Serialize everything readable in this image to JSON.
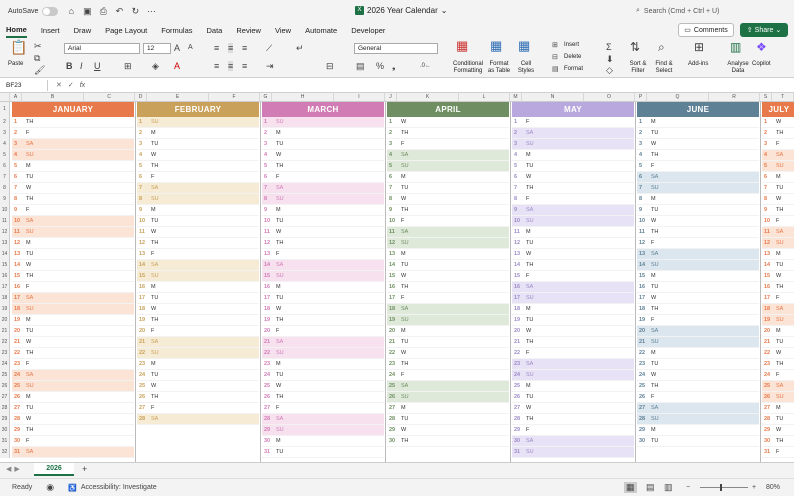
{
  "titlebar": {
    "autosave_label": "AutoSave",
    "doc_title": "2026 Year Calendar",
    "search_placeholder": "Search (Cmd + Ctrl + U)"
  },
  "menu": {
    "tabs": [
      "Home",
      "Insert",
      "Draw",
      "Page Layout",
      "Formulas",
      "Data",
      "Review",
      "View",
      "Automate",
      "Developer"
    ],
    "active": "Home",
    "comments_label": "Comments",
    "share_label": "Share"
  },
  "ribbon": {
    "paste": "Paste",
    "font_name": "Arial",
    "font_size": "12",
    "number_format": "General",
    "insert": "Insert",
    "delete": "Delete",
    "format": "Format",
    "cond_format_1": "Conditional",
    "cond_format_2": "Formatting",
    "format_table_1": "Format",
    "format_table_2": "as Table",
    "cell_styles_1": "Cell",
    "cell_styles_2": "Styles",
    "sort_1": "Sort &",
    "sort_2": "Filter",
    "find_1": "Find &",
    "find_2": "Select",
    "addins": "Add-ins",
    "analyse_1": "Analyse",
    "analyse_2": "Data",
    "copilot": "Copilot"
  },
  "formula": {
    "name_box": "BF23",
    "fx": "fx"
  },
  "columns": [
    "A",
    "B",
    "C",
    "D",
    "E",
    "F",
    "G",
    "H",
    "I",
    "J",
    "K",
    "L",
    "M",
    "N",
    "O",
    "P",
    "Q",
    "R",
    "S",
    "T"
  ],
  "rows": [
    "1",
    "2",
    "3",
    "4",
    "5",
    "6",
    "7",
    "8",
    "9",
    "10",
    "11",
    "12",
    "13",
    "14",
    "15",
    "16",
    "17",
    "18",
    "19",
    "20",
    "21",
    "22",
    "23",
    "24",
    "25",
    "26",
    "27",
    "28",
    "29",
    "30",
    "31",
    "32"
  ],
  "months": [
    {
      "name": "JANUARY",
      "color": "#e8794a",
      "shade": "#fbe3d6",
      "text": "#e8794a",
      "first": 4,
      "days": 31
    },
    {
      "name": "FEBRUARY",
      "color": "#c9a15a",
      "shade": "#f6ecd6",
      "text": "#c9a15a",
      "first": 0,
      "days": 28
    },
    {
      "name": "MARCH",
      "color": "#d27cb6",
      "shade": "#f7e1ef",
      "text": "#d27cb6",
      "first": 0,
      "days": 31
    },
    {
      "name": "APRIL",
      "color": "#6f8f62",
      "shade": "#dfe9da",
      "text": "#6f8f62",
      "first": 3,
      "days": 30
    },
    {
      "name": "MAY",
      "color": "#b9a8de",
      "shade": "#e7e2f6",
      "text": "#9d8cc6",
      "first": 5,
      "days": 31
    },
    {
      "name": "JUNE",
      "color": "#5f8196",
      "shade": "#dce6ee",
      "text": "#5f8196",
      "first": 1,
      "days": 30
    },
    {
      "name": "JULY",
      "color": "#e8794a",
      "shade": "#fbe3d6",
      "text": "#e8794a",
      "first": 3,
      "days": 31
    }
  ],
  "weekdays": [
    "SU",
    "M",
    "TU",
    "W",
    "TH",
    "F",
    "SA"
  ],
  "sheet": {
    "tab": "2026"
  },
  "status": {
    "ready": "Ready",
    "accessibility": "Accessibility: Investigate",
    "zoom": "80%"
  }
}
